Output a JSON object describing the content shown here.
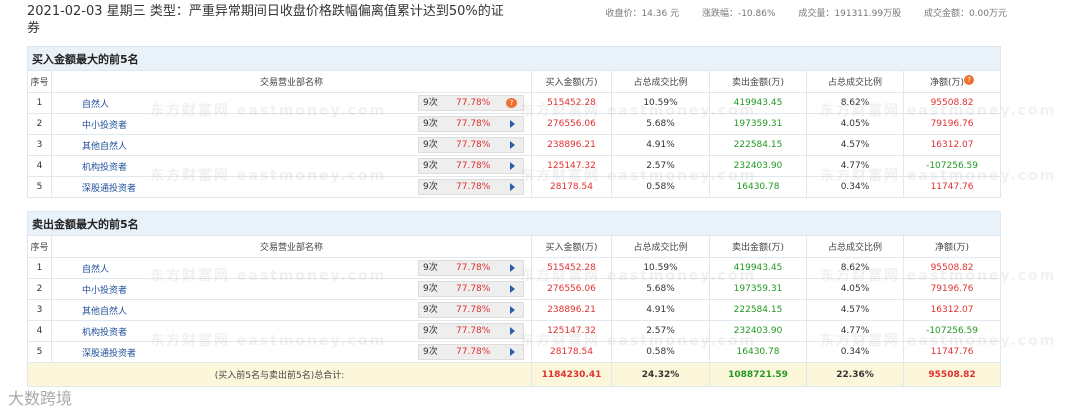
{
  "header": {
    "title": "2021-02-03 星期三  类型：严重异常期间日收盘价格跌幅偏离值累计达到50%的证券",
    "close_label": "收盘价：14.36 元",
    "change_label": "涨跌幅：-10.86%",
    "volume_label": "成交量：191311.99万股",
    "amount_label": "成交金额：0.00万元"
  },
  "buy_section": {
    "title": "买入金额最大的前5名",
    "headers": [
      "序号",
      "交易营业部名称",
      "买入金额(万)",
      "占总成交比例",
      "卖出金额(万)",
      "占总成交比例",
      "净额(万)"
    ],
    "rows": [
      {
        "idx": "1",
        "name": "自然人",
        "times": "9次",
        "pct": "77.78%",
        "buy": "515452.28",
        "buy_ratio": "10.59%",
        "sell": "419943.45",
        "sell_ratio": "8.62%",
        "net": "95508.82"
      },
      {
        "idx": "2",
        "name": "中小投资者",
        "times": "9次",
        "pct": "77.78%",
        "buy": "276556.06",
        "buy_ratio": "5.68%",
        "sell": "197359.31",
        "sell_ratio": "4.05%",
        "net": "79196.76"
      },
      {
        "idx": "3",
        "name": "其他自然人",
        "times": "9次",
        "pct": "77.78%",
        "buy": "238896.21",
        "buy_ratio": "4.91%",
        "sell": "222584.15",
        "sell_ratio": "4.57%",
        "net": "16312.07"
      },
      {
        "idx": "4",
        "name": "机构投资者",
        "times": "9次",
        "pct": "77.78%",
        "buy": "125147.32",
        "buy_ratio": "2.57%",
        "sell": "232403.90",
        "sell_ratio": "4.77%",
        "net": "-107256.59"
      },
      {
        "idx": "5",
        "name": "深股通投资者",
        "times": "9次",
        "pct": "77.78%",
        "buy": "28178.54",
        "buy_ratio": "0.58%",
        "sell": "16430.78",
        "sell_ratio": "0.34%",
        "net": "11747.76"
      }
    ]
  },
  "sell_section": {
    "title": "卖出金额最大的前5名",
    "headers": [
      "序号",
      "交易营业部名称",
      "买入金额(万)",
      "占总成交比例",
      "卖出金额(万)",
      "占总成交比例",
      "净额(万)"
    ],
    "rows": [
      {
        "idx": "1",
        "name": "自然人",
        "times": "9次",
        "pct": "77.78%",
        "buy": "515452.28",
        "buy_ratio": "10.59%",
        "sell": "419943.45",
        "sell_ratio": "8.62%",
        "net": "95508.82"
      },
      {
        "idx": "2",
        "name": "中小投资者",
        "times": "9次",
        "pct": "77.78%",
        "buy": "276556.06",
        "buy_ratio": "5.68%",
        "sell": "197359.31",
        "sell_ratio": "4.05%",
        "net": "79196.76"
      },
      {
        "idx": "3",
        "name": "其他自然人",
        "times": "9次",
        "pct": "77.78%",
        "buy": "238896.21",
        "buy_ratio": "4.91%",
        "sell": "222584.15",
        "sell_ratio": "4.57%",
        "net": "16312.07"
      },
      {
        "idx": "4",
        "name": "机构投资者",
        "times": "9次",
        "pct": "77.78%",
        "buy": "125147.32",
        "buy_ratio": "2.57%",
        "sell": "232403.90",
        "sell_ratio": "4.77%",
        "net": "-107256.59"
      },
      {
        "idx": "5",
        "name": "深股通投资者",
        "times": "9次",
        "pct": "77.78%",
        "buy": "28178.54",
        "buy_ratio": "0.58%",
        "sell": "16430.78",
        "sell_ratio": "0.34%",
        "net": "11747.76"
      }
    ]
  },
  "total": {
    "label": "(买入前5名与卖出前5名)总合计:",
    "buy": "1184230.41",
    "buy_ratio": "24.32%",
    "sell": "1088721.59",
    "sell_ratio": "22.36%",
    "net": "95508.82"
  },
  "watermark": "东方财富网 eastmoney.com",
  "footer_logo": "大数跨境",
  "colors": {
    "positive": "#e03030",
    "negative": "#229922",
    "link": "#1f4e9a",
    "section_bg": "#eaf2f9",
    "total_bg": "#fcf7da"
  },
  "icons": {
    "info_bubble": "info-bubble-icon",
    "expand_arrow": "expand-arrow-icon"
  }
}
